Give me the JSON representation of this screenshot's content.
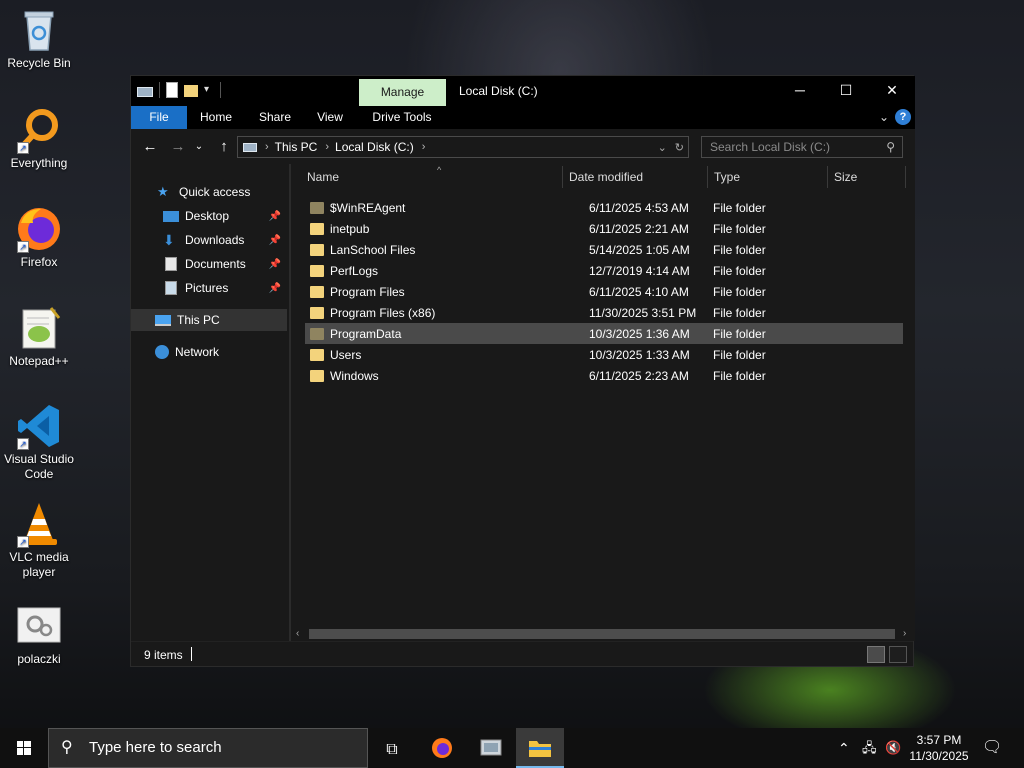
{
  "desktop": {
    "icons": [
      {
        "label": "Recycle Bin",
        "icon": "recycle-bin-icon"
      },
      {
        "label": "Everything",
        "icon": "everything-search-icon"
      },
      {
        "label": "Firefox",
        "icon": "firefox-icon"
      },
      {
        "label": "Notepad++",
        "icon": "notepad-plus-plus-icon"
      },
      {
        "label": "Visual Studio Code",
        "icon": "vscode-icon"
      },
      {
        "label": "VLC media player",
        "icon": "vlc-icon"
      },
      {
        "label": "polaczki",
        "icon": "settings-gears-icon"
      }
    ]
  },
  "window": {
    "title": "Local Disk (C:)",
    "contextual_tab": "Manage",
    "ribbon_tabs": [
      "File",
      "Home",
      "Share",
      "View",
      "Drive Tools"
    ],
    "minimize": "─",
    "maximize": "☐",
    "close": "✕",
    "help": "?"
  },
  "address": {
    "crumbs": [
      "This PC",
      "Local Disk (C:)"
    ],
    "search_placeholder": "Search Local Disk (C:)"
  },
  "navpane": {
    "quick_access": "Quick access",
    "pinned": [
      "Desktop",
      "Downloads",
      "Documents",
      "Pictures"
    ],
    "this_pc": "This PC",
    "network": "Network"
  },
  "columns": [
    "Name",
    "Date modified",
    "Type",
    "Size"
  ],
  "files": [
    {
      "name": "$WinREAgent",
      "date": "6/11/2025 4:53 AM",
      "type": "File folder",
      "hidden": true
    },
    {
      "name": "inetpub",
      "date": "6/11/2025 2:21 AM",
      "type": "File folder",
      "hidden": false
    },
    {
      "name": "LanSchool Files",
      "date": "5/14/2025 1:05 AM",
      "type": "File folder",
      "hidden": false
    },
    {
      "name": "PerfLogs",
      "date": "12/7/2019 4:14 AM",
      "type": "File folder",
      "hidden": false
    },
    {
      "name": "Program Files",
      "date": "6/11/2025 4:10 AM",
      "type": "File folder",
      "hidden": false
    },
    {
      "name": "Program Files (x86)",
      "date": "11/30/2025 3:51 PM",
      "type": "File folder",
      "hidden": false
    },
    {
      "name": "ProgramData",
      "date": "10/3/2025 1:36 AM",
      "type": "File folder",
      "hidden": true
    },
    {
      "name": "Users",
      "date": "10/3/2025 1:33 AM",
      "type": "File folder",
      "hidden": false
    },
    {
      "name": "Windows",
      "date": "6/11/2025 2:23 AM",
      "type": "File folder",
      "hidden": false
    }
  ],
  "selected_file": "ProgramData",
  "status": {
    "item_count": "9 items"
  },
  "taskbar": {
    "search_placeholder": "Type here to search",
    "time": "3:57 PM",
    "date": "11/30/2025"
  },
  "colors": {
    "accent": "#1a6fc6",
    "manage_tab": "#cdeec9",
    "folder": "#f3d37c",
    "hidden_folder": "#8f8460"
  }
}
